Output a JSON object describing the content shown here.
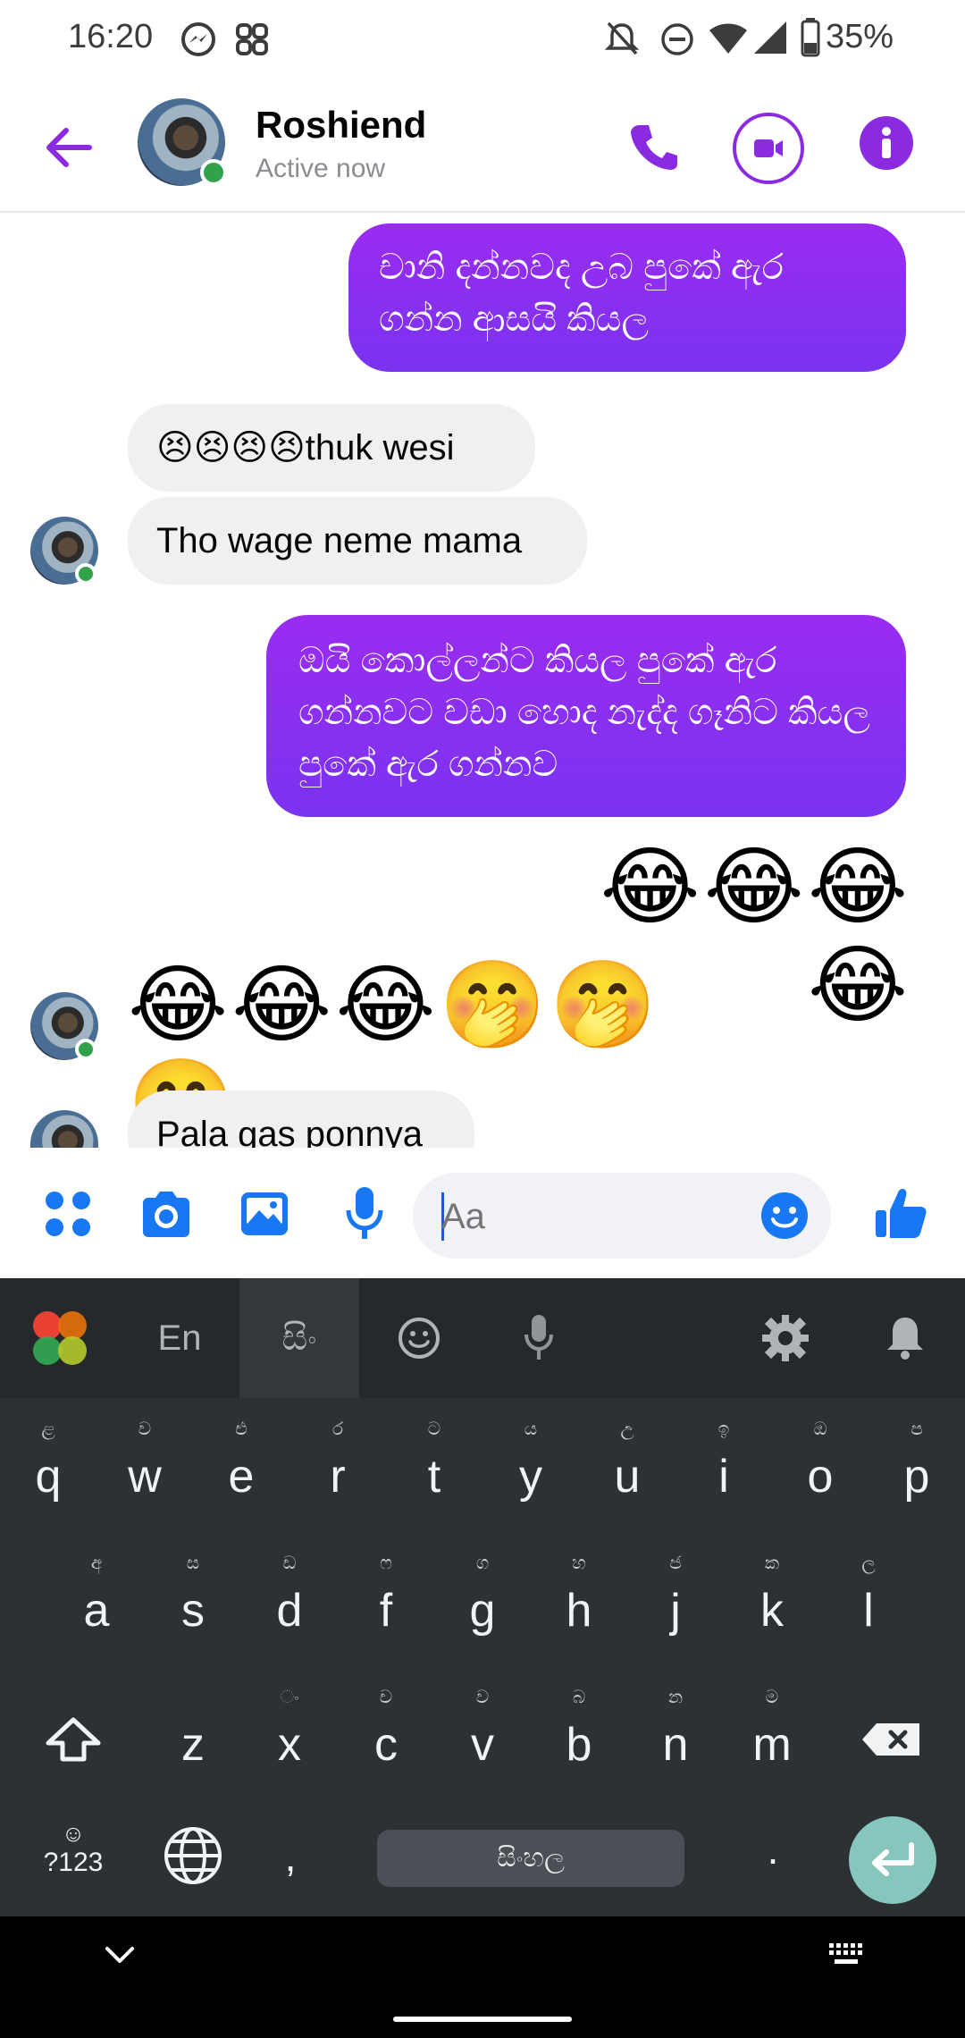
{
  "status_bar": {
    "time": "16:20",
    "battery": "35%"
  },
  "header": {
    "name": "Roshiend",
    "status": "Active now"
  },
  "messages": [
    {
      "from": "me",
      "text": "චානි දන්නවද උබ පුකේ ඇර ගන්න ආසයි කියල"
    },
    {
      "from": "them",
      "text": "😣😣😣😣thuk wesi"
    },
    {
      "from": "them",
      "text": "Tho wage neme mama"
    },
    {
      "from": "me",
      "text": "ඔයි කොල්ලන්ට කියල පුකේ ඇර ගන්නවට වඩා හොද නැද්ද ගෑනිට කියල පුකේ ඇර ගන්නව"
    },
    {
      "from": "me",
      "text": "😂😂😂😂"
    },
    {
      "from": "them",
      "text": "😂😂😂🤭🤭🤭"
    },
    {
      "from": "them",
      "text": "Pala gas ponnya"
    }
  ],
  "composer": {
    "placeholder": "Aa"
  },
  "keyboard": {
    "toolbar": {
      "lang_en": "En",
      "lang_si": "සිං"
    },
    "row1": [
      {
        "k": "q",
        "h": "ළ"
      },
      {
        "k": "w",
        "h": "ව"
      },
      {
        "k": "e",
        "h": "එ"
      },
      {
        "k": "r",
        "h": "ර"
      },
      {
        "k": "t",
        "h": "ට"
      },
      {
        "k": "y",
        "h": "ය"
      },
      {
        "k": "u",
        "h": "උ"
      },
      {
        "k": "i",
        "h": "ඉ"
      },
      {
        "k": "o",
        "h": "ඔ"
      },
      {
        "k": "p",
        "h": "ප"
      }
    ],
    "row2": [
      {
        "k": "a",
        "h": "අ"
      },
      {
        "k": "s",
        "h": "ස"
      },
      {
        "k": "d",
        "h": "ඩ"
      },
      {
        "k": "f",
        "h": "ෆ"
      },
      {
        "k": "g",
        "h": "ග"
      },
      {
        "k": "h",
        "h": "හ"
      },
      {
        "k": "j",
        "h": "ජ"
      },
      {
        "k": "k",
        "h": "ක"
      },
      {
        "k": "l",
        "h": "ල"
      }
    ],
    "row3": [
      {
        "k": "z",
        "h": ""
      },
      {
        "k": "x",
        "h": "ං"
      },
      {
        "k": "c",
        "h": "ච"
      },
      {
        "k": "v",
        "h": "ව"
      },
      {
        "k": "b",
        "h": "බ"
      },
      {
        "k": "n",
        "h": "න"
      },
      {
        "k": "m",
        "h": "ම"
      }
    ],
    "symbols_label": "?123",
    "comma": ",",
    "period": ".",
    "space_label": "සිංහල"
  },
  "colors": {
    "accent": "#8a2be2",
    "online": "#31a24c",
    "keyboard_bg": "#2c3134"
  }
}
